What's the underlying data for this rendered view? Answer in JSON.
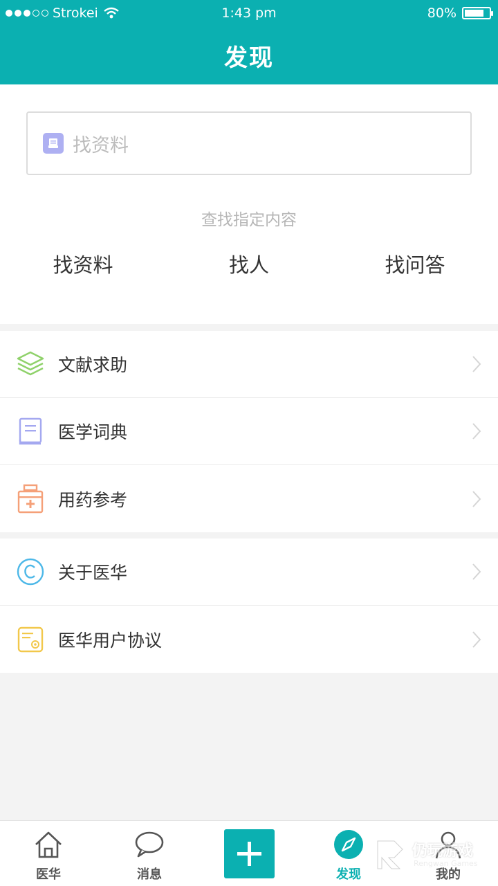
{
  "status_bar": {
    "carrier": "Strokei",
    "time": "1:43 pm",
    "battery": "80%",
    "battery_level": 0.8
  },
  "header": {
    "title": "发现"
  },
  "search": {
    "placeholder": "找资料",
    "hint": "查找指定内容",
    "quick_links": [
      "找资料",
      "找人",
      "找问答"
    ]
  },
  "tools": [
    {
      "label": "文献求助",
      "icon": "layers-icon",
      "color": "#8fd16a"
    },
    {
      "label": "医学词典",
      "icon": "book-icon",
      "color": "#a4a8f0"
    },
    {
      "label": "用药参考",
      "icon": "medicine-bottle-icon",
      "color": "#f5a078"
    }
  ],
  "about": [
    {
      "label": "关于医华",
      "icon": "copyright-icon",
      "color": "#4db8e8"
    },
    {
      "label": "医华用户协议",
      "icon": "certificate-icon",
      "color": "#f2c84b"
    }
  ],
  "tabbar": {
    "tabs": [
      {
        "label": "医华",
        "icon": "home-icon"
      },
      {
        "label": "消息",
        "icon": "chat-bubble-icon"
      },
      {
        "label": "",
        "icon": "plus-icon"
      },
      {
        "label": "发现",
        "icon": "compass-icon",
        "active": true
      },
      {
        "label": "我的",
        "icon": "person-icon"
      }
    ],
    "accent": "#0bb0b1"
  },
  "watermark": {
    "text": "仍玩游戏",
    "sub": "Rengwan Games"
  }
}
